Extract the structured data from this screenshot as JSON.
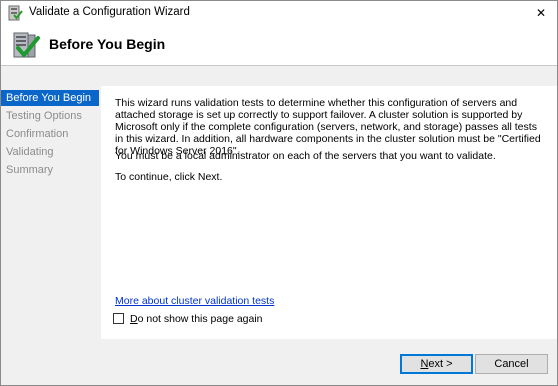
{
  "window": {
    "title": "Validate a Configuration Wizard",
    "icon": "validation-wizard-icon",
    "close_label": "✕"
  },
  "header": {
    "title": "Before You Begin",
    "icon": "green-check-server-icon"
  },
  "sidebar": {
    "items": [
      {
        "label": "Before You Begin",
        "active": true
      },
      {
        "label": "Testing Options",
        "active": false
      },
      {
        "label": "Confirmation",
        "active": false
      },
      {
        "label": "Validating",
        "active": false
      },
      {
        "label": "Summary",
        "active": false
      }
    ]
  },
  "content": {
    "paragraph1": "This wizard runs validation tests to determine whether this configuration of servers and attached storage is set up correctly to support failover. A cluster solution is supported by Microsoft only if the complete configuration (servers, network, and storage) passes all tests in this wizard. In addition, all hardware components in the cluster solution must be \"Certified for Windows Server 2016\".",
    "paragraph2": "You must be a local administrator on each of the servers that you want to validate.",
    "paragraph3": "To continue, click Next.",
    "link": "More about cluster validation tests",
    "checkbox_accel": "D",
    "checkbox_rest": "o not show this page again",
    "checkbox_checked": false
  },
  "buttons": {
    "next_accel": "N",
    "next_rest": "ext >",
    "cancel": "Cancel"
  },
  "colors": {
    "accent": "#0a66c8",
    "link": "#0033cc",
    "disabled_text": "#8c8c8c"
  }
}
